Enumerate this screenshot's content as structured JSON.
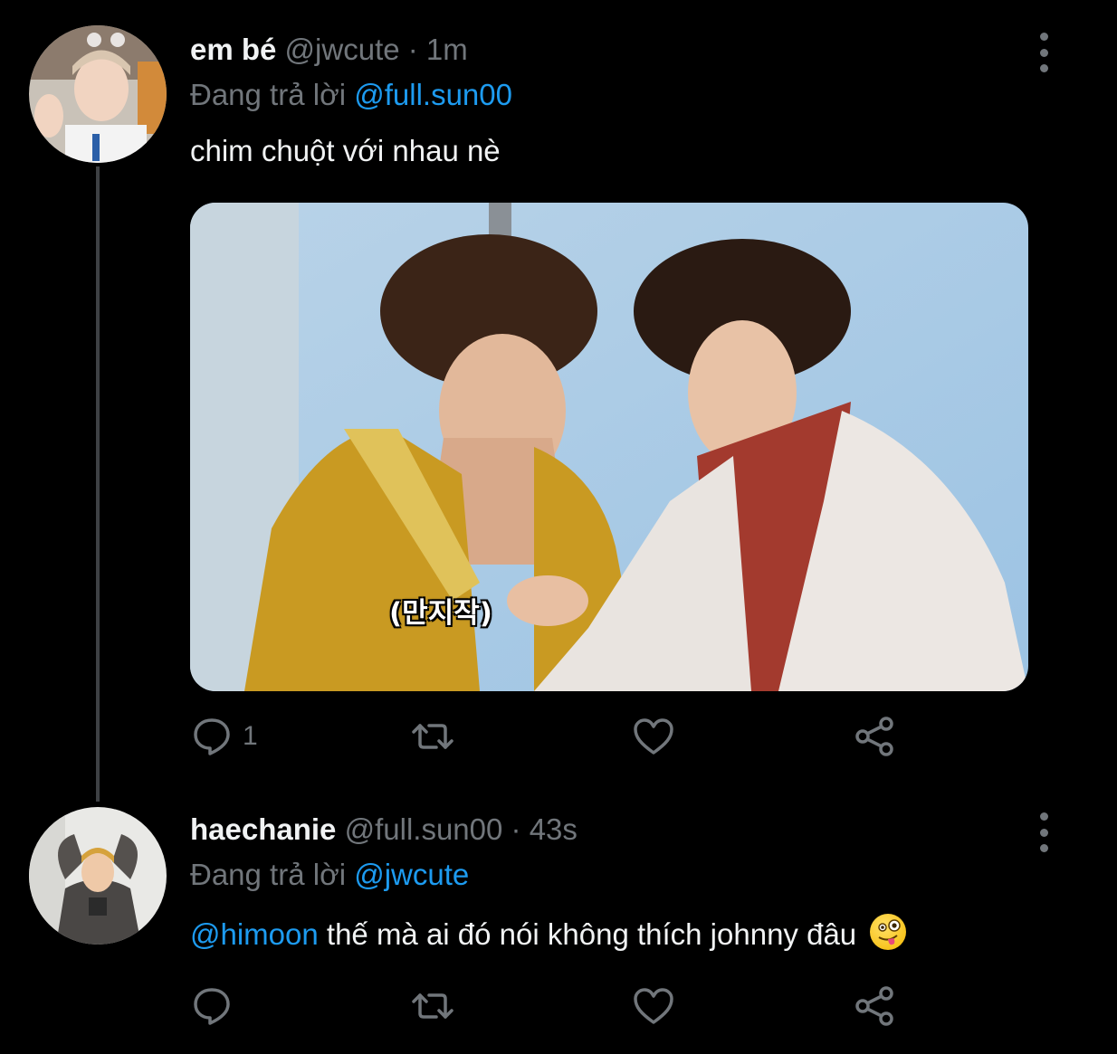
{
  "tweets": [
    {
      "display_name": "em bé",
      "handle": "@jwcute",
      "time": "· 1m",
      "replying_prefix": "Đang trả lời",
      "replying_to": "@full.sun00",
      "text": "chim chuột với nhau nè",
      "media_caption": "(만지작)",
      "reply_count": "1"
    },
    {
      "display_name": "haechanie",
      "handle": "@full.sun00",
      "time": "· 43s",
      "replying_prefix": "Đang trả lời",
      "replying_to": "@jwcute",
      "mention": "@himoon",
      "text": " thế mà ai đó nói không thích johnny đâu",
      "emoji_name": "zany-face-emoji"
    }
  ],
  "colors": {
    "background": "#000000",
    "link": "#1d9bf0",
    "muted": "#71767b"
  },
  "icons": [
    "reply-icon",
    "retweet-icon",
    "like-icon",
    "share-icon",
    "more-options-icon"
  ]
}
